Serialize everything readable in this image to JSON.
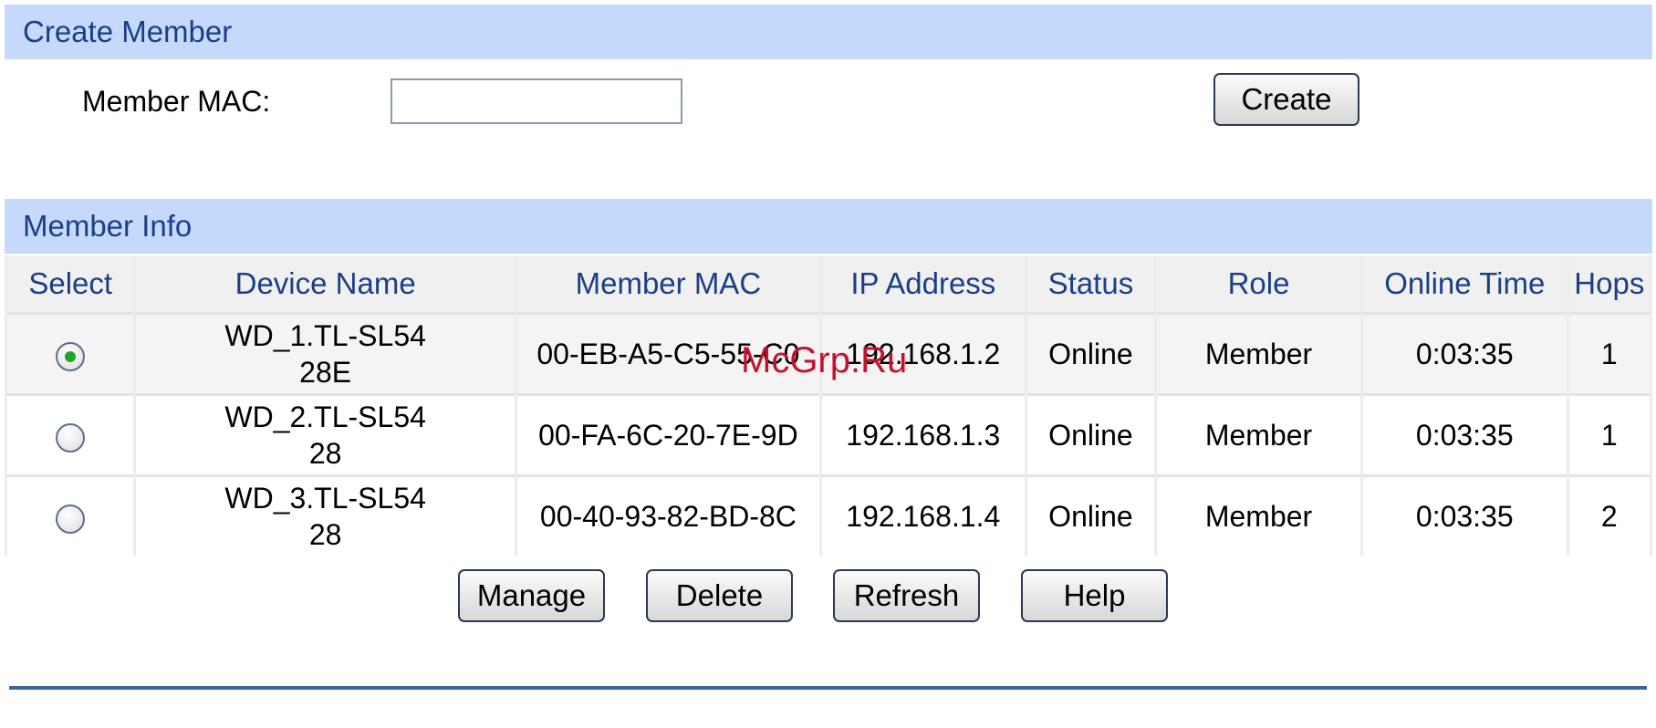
{
  "create_section": {
    "title": "Create Member",
    "mac_label": "Member MAC:",
    "mac_value": "",
    "mac_placeholder": "",
    "create_button": "Create"
  },
  "info_section": {
    "title": "Member Info",
    "columns": [
      "Select",
      "Device Name",
      "Member MAC",
      "IP Address",
      "Status",
      "Role",
      "Online Time",
      "Hops"
    ],
    "rows": [
      {
        "selected": true,
        "device_name_line1": "WD_1.TL-SL54",
        "device_name_line2": "28E",
        "mac": "00-EB-A5-C5-55-C0",
        "ip": "192.168.1.2",
        "status": "Online",
        "role": "Member",
        "online_time": "0:03:35",
        "hops": "1"
      },
      {
        "selected": false,
        "device_name_line1": "WD_2.TL-SL54",
        "device_name_line2": "28",
        "mac": "00-FA-6C-20-7E-9D",
        "ip": "192.168.1.3",
        "status": "Online",
        "role": "Member",
        "online_time": "0:03:35",
        "hops": "1"
      },
      {
        "selected": false,
        "device_name_line1": "WD_3.TL-SL54",
        "device_name_line2": "28",
        "mac": "00-40-93-82-BD-8C",
        "ip": "192.168.1.4",
        "status": "Online",
        "role": "Member",
        "online_time": "0:03:35",
        "hops": "2"
      }
    ]
  },
  "actions": {
    "manage": "Manage",
    "delete": "Delete",
    "refresh": "Refresh",
    "help": "Help"
  },
  "watermark": "McGrp.Ru",
  "colors": {
    "header_bg": "#c5d9fb",
    "header_text": "#1b3f86",
    "radio_selected": "#1fa52a",
    "bottom_rule": "#3b6699"
  }
}
